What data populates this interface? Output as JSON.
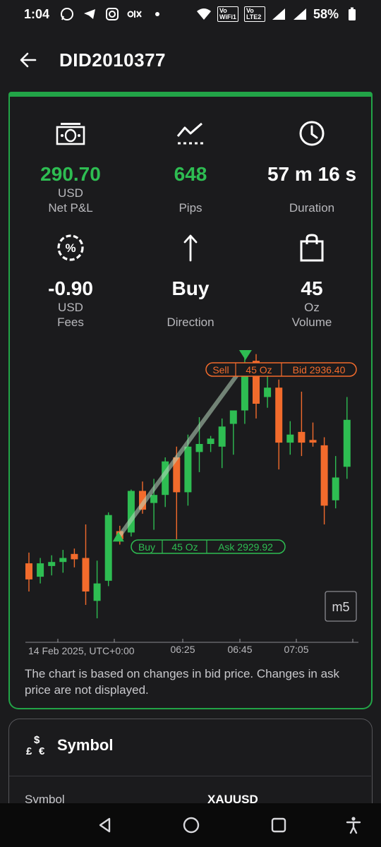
{
  "status_bar": {
    "time": "1:04",
    "left_icons": [
      "whatsapp-icon",
      "telegram-icon",
      "instagram-icon",
      "olx-icon",
      "dot-icon"
    ],
    "right_icons": [
      "wifi-icon",
      "vowifi-icon",
      "volte-icon",
      "signal-icon",
      "signal-icon",
      "battery-icon"
    ],
    "vowifi": "Vo WiFi1",
    "volte": "Vo LTE2",
    "battery": "58%"
  },
  "app_bar": {
    "title": "DID2010377"
  },
  "stats": {
    "net_pl": {
      "icon": "banknote-icon",
      "value": "290.70",
      "unit": "USD",
      "label": "Net P&L"
    },
    "pips": {
      "icon": "trend-line-icon",
      "value": "648",
      "label": "Pips"
    },
    "duration": {
      "icon": "clock-icon",
      "value": "57 m 16 s",
      "label": "Duration"
    },
    "fees": {
      "icon": "percent-badge-icon",
      "value": "-0.90",
      "unit": "USD",
      "label": "Fees"
    },
    "direction": {
      "icon": "arrow-up-icon",
      "value": "Buy",
      "label": "Direction"
    },
    "volume": {
      "icon": "shopping-bag-icon",
      "value": "45",
      "unit": "Oz",
      "label": "Volume"
    }
  },
  "chart_data": {
    "type": "candlestick",
    "timeframe": "m5",
    "x_labels": [
      "14 Feb 2025, UTC+0:00",
      "06:25",
      "06:45",
      "07:05"
    ],
    "entry": {
      "side": "Buy",
      "volume": "45 Oz",
      "price_label": "Ask 2929.92",
      "price": 2929.92
    },
    "exit": {
      "side": "Sell",
      "volume": "45 Oz",
      "price_label": "Bid 2936.40",
      "price": 2936.4
    },
    "candles": [
      {
        "o": 2928.95,
        "h": 2929.35,
        "l": 2927.9,
        "c": 2928.35
      },
      {
        "o": 2928.45,
        "h": 2929.15,
        "l": 2928.2,
        "c": 2928.95
      },
      {
        "o": 2928.85,
        "h": 2929.25,
        "l": 2928.5,
        "c": 2929.0
      },
      {
        "o": 2929.0,
        "h": 2929.45,
        "l": 2928.6,
        "c": 2929.15
      },
      {
        "o": 2929.3,
        "h": 2929.5,
        "l": 2928.8,
        "c": 2929.1
      },
      {
        "o": 2929.15,
        "h": 2930.4,
        "l": 2927.4,
        "c": 2927.9
      },
      {
        "o": 2927.55,
        "h": 2929.05,
        "l": 2926.9,
        "c": 2928.2
      },
      {
        "o": 2928.3,
        "h": 2930.85,
        "l": 2928.1,
        "c": 2930.75
      },
      {
        "o": 2930.15,
        "h": 2930.35,
        "l": 2929.65,
        "c": 2929.85
      },
      {
        "o": 2930.1,
        "h": 2931.7,
        "l": 2929.95,
        "c": 2931.65
      },
      {
        "o": 2931.65,
        "h": 2932.0,
        "l": 2930.8,
        "c": 2930.95
      },
      {
        "o": 2931.2,
        "h": 2932.1,
        "l": 2930.2,
        "c": 2931.5
      },
      {
        "o": 2931.5,
        "h": 2932.9,
        "l": 2931.05,
        "c": 2932.75
      },
      {
        "o": 2932.9,
        "h": 2933.3,
        "l": 2929.85,
        "c": 2931.6
      },
      {
        "o": 2931.6,
        "h": 2933.75,
        "l": 2931.1,
        "c": 2933.3
      },
      {
        "o": 2933.1,
        "h": 2934.4,
        "l": 2932.35,
        "c": 2933.4
      },
      {
        "o": 2933.4,
        "h": 2933.7,
        "l": 2933.1,
        "c": 2933.6
      },
      {
        "o": 2933.3,
        "h": 2934.35,
        "l": 2932.5,
        "c": 2934.05
      },
      {
        "o": 2934.15,
        "h": 2934.55,
        "l": 2933.0,
        "c": 2934.65
      },
      {
        "o": 2934.65,
        "h": 2936.9,
        "l": 2934.15,
        "c": 2936.4
      },
      {
        "o": 2936.5,
        "h": 2936.75,
        "l": 2934.35,
        "c": 2934.9
      },
      {
        "o": 2935.15,
        "h": 2936.0,
        "l": 2934.75,
        "c": 2935.5
      },
      {
        "o": 2935.5,
        "h": 2935.8,
        "l": 2932.45,
        "c": 2933.45
      },
      {
        "o": 2933.45,
        "h": 2934.25,
        "l": 2933.0,
        "c": 2933.75
      },
      {
        "o": 2933.85,
        "h": 2935.35,
        "l": 2932.95,
        "c": 2933.45
      },
      {
        "o": 2933.55,
        "h": 2934.2,
        "l": 2933.3,
        "c": 2933.45
      },
      {
        "o": 2933.35,
        "h": 2933.65,
        "l": 2930.4,
        "c": 2931.1
      },
      {
        "o": 2931.3,
        "h": 2932.95,
        "l": 2931.0,
        "c": 2932.15
      },
      {
        "o": 2932.55,
        "h": 2935.15,
        "l": 2932.1,
        "c": 2934.3
      }
    ],
    "colors": {
      "up": "#2ebd52",
      "down": "#f26b2c",
      "axis": "#9a9aa0"
    }
  },
  "chart_note": "The chart is based on changes in bid price. Changes in ask price are not displayed.",
  "symbol_section": {
    "icon": "currency-symbols-icon",
    "title": "Symbol",
    "row_label": "Symbol",
    "row_value": "XAUUSD"
  },
  "nav_bar": {
    "icons": [
      "back-triangle-icon",
      "home-circle-icon",
      "recents-square-icon",
      "accessibility-icon"
    ]
  }
}
